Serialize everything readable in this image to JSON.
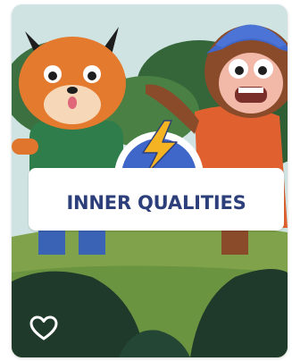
{
  "card": {
    "title": "INNER QUALITIES",
    "badge_icon": "lightning-bolt-icon",
    "favorite_icon": "heart-outline-icon",
    "colors": {
      "title": "#2c3f7a",
      "badge_blue": "#3f66c9",
      "bolt": "#f3b323"
    }
  }
}
